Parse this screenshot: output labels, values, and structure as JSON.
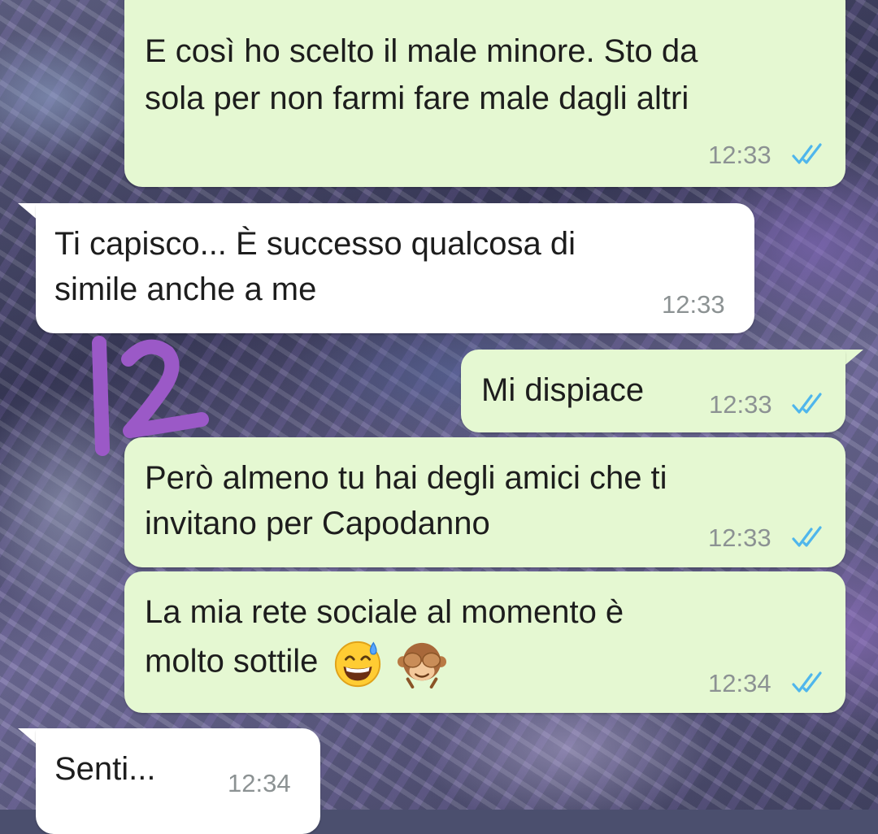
{
  "conversation": {
    "messages": [
      {
        "direction": "outgoing",
        "lines": [
          "E così ho scelto il male minore. Sto da",
          "sola per non farmi fare male dagli altri"
        ],
        "time": "12:33",
        "status": "read"
      },
      {
        "direction": "incoming",
        "lines": [
          "Ti capisco... È successo qualcosa di",
          "simile anche a me"
        ],
        "time": "12:33"
      },
      {
        "direction": "outgoing",
        "lines": [
          "Mi dispiace"
        ],
        "time": "12:33",
        "status": "read"
      },
      {
        "direction": "outgoing",
        "lines": [
          "Però almeno tu hai degli amici che ti",
          "invitano per Capodanno"
        ],
        "time": "12:33",
        "status": "read"
      },
      {
        "direction": "outgoing",
        "lines": [
          "La mia rete sociale al momento è",
          "molto sottile"
        ],
        "emojis": [
          "grinning-sweat-emoji",
          "see-no-evil-monkey-emoji"
        ],
        "time": "12:34",
        "status": "read"
      },
      {
        "direction": "incoming",
        "lines": [
          "Senti..."
        ],
        "time": "12:34"
      }
    ]
  },
  "annotation": {
    "text": "12",
    "color": "#9b59c7"
  },
  "colors": {
    "outgoing_bubble": "#e5f8d2",
    "incoming_bubble": "#ffffff",
    "read_ticks": "#4fb6ec",
    "timestamp": "#8c9293"
  }
}
